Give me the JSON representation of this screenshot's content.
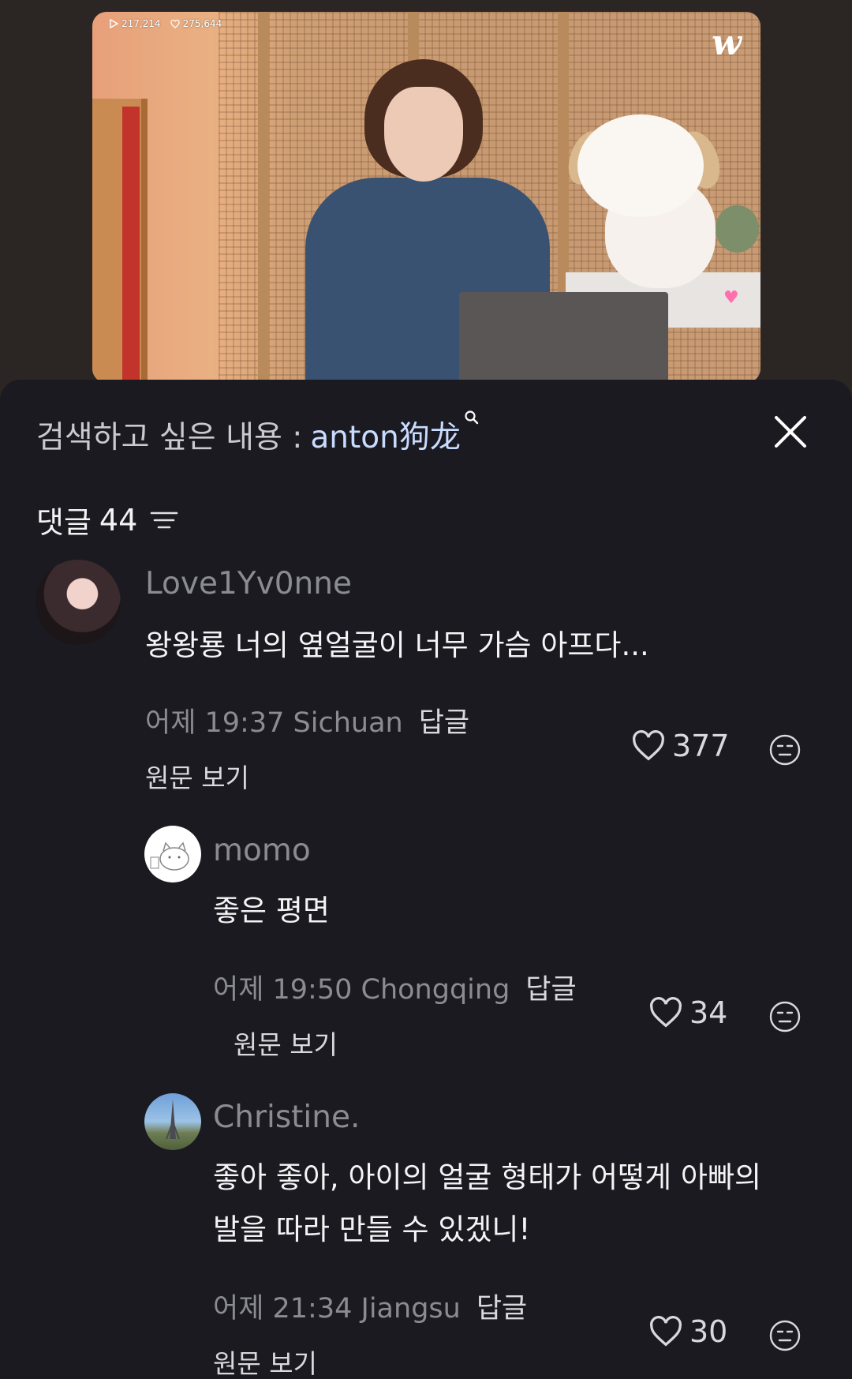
{
  "video": {
    "views": "217,214",
    "likes": "275,644",
    "logo": "w",
    "play_icon": "play-icon",
    "heart_icon": "heart-outline-icon"
  },
  "search": {
    "label": "검색하고 싶은 내용 :",
    "term": "anton狗龙",
    "icon": "search-icon",
    "close_icon": "close-icon"
  },
  "comments_header": {
    "label": "댓글",
    "count": "44",
    "sort_icon": "sort-icon"
  },
  "comments": [
    {
      "username": "Love1Yv0nne",
      "text": "왕왕룡 너의 옆얼굴이 너무 가슴 아프다...",
      "meta": "어제 19:37 Sichuan",
      "reply_label": "답글",
      "original_label": "원문 보기",
      "likes": "377"
    },
    {
      "username": "momo",
      "text": "좋은 평면",
      "meta": "어제 19:50 Chongqing",
      "reply_label": "답글",
      "original_label": "원문 보기",
      "likes": "34"
    },
    {
      "username": "Christine.",
      "text_line1": "좋아 좋아, 아이의 얼굴 형태가 어떻게 아빠의",
      "text_line2": "발을 따라 만들 수 있겠니!",
      "meta": "어제 21:34 Jiangsu",
      "reply_label": "답글",
      "original_label": "원문 보기",
      "likes": "30"
    }
  ],
  "colors": {
    "background": "#1a1a20",
    "accent_term": "#c9dcff",
    "muted": "#8b8b92"
  }
}
